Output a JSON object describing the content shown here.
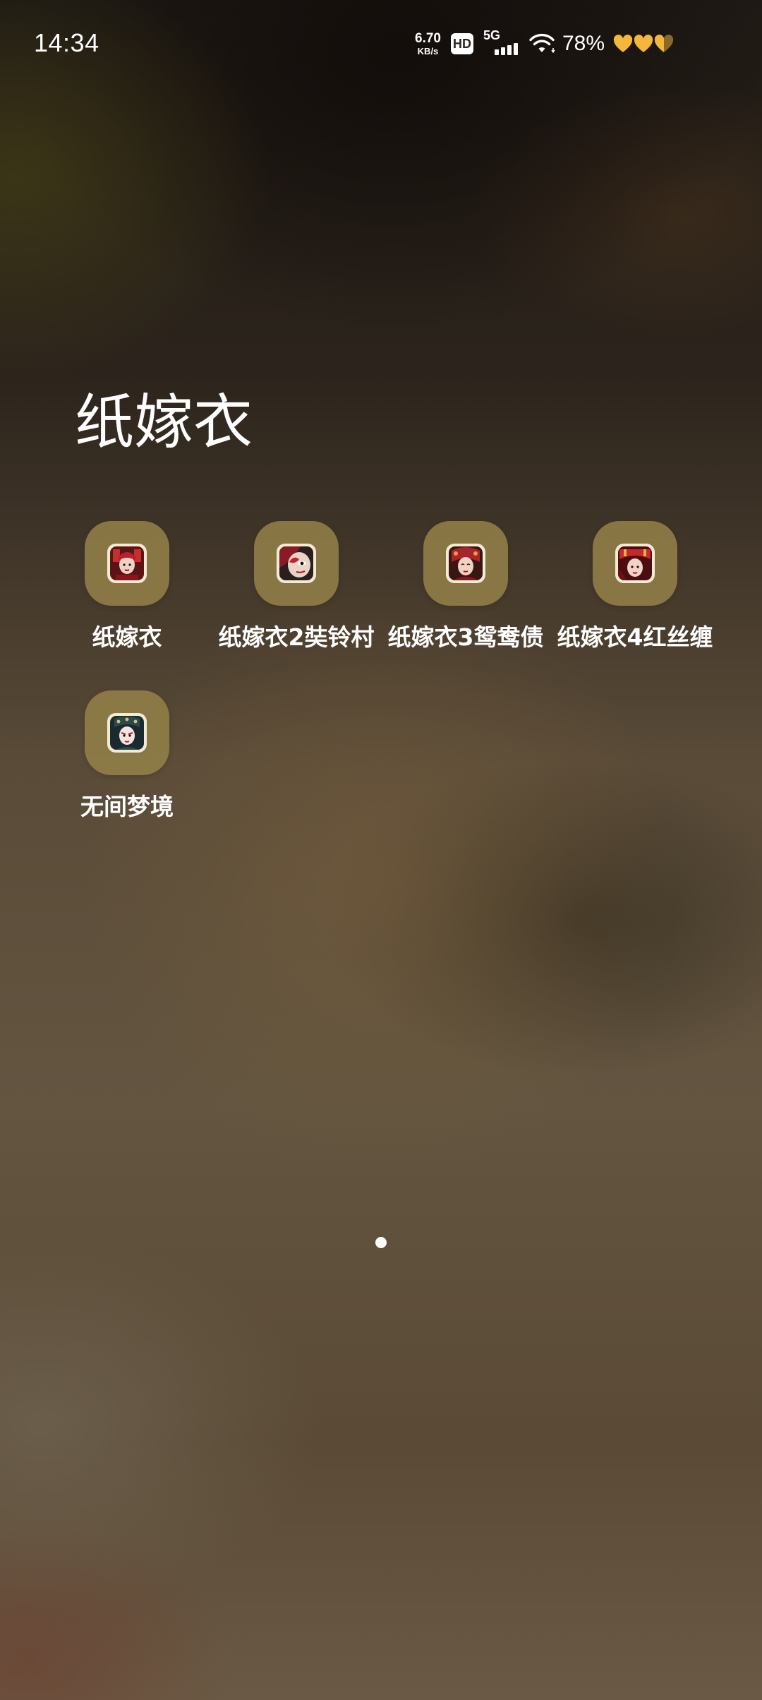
{
  "status_bar": {
    "time": "14:34",
    "net_speed_value": "6.70",
    "net_speed_unit": "KB/s",
    "hd_badge": "HD",
    "network_type": "5G",
    "battery_percent": "78%",
    "icons": [
      "wifi-icon",
      "signal-icon",
      "heart-battery-icon"
    ]
  },
  "folder": {
    "title": "纸嫁衣",
    "apps": [
      {
        "label": "纸嫁衣",
        "icon": "app-icon-zhijiayi"
      },
      {
        "label": "纸嫁衣2奘铃村",
        "icon": "app-icon-zhijiayi2"
      },
      {
        "label": "纸嫁衣3鸳鸯债",
        "icon": "app-icon-zhijiayi3"
      },
      {
        "label": "纸嫁衣4红丝缠",
        "icon": "app-icon-zhijiayi4"
      },
      {
        "label": "无间梦境",
        "icon": "app-icon-wujianmengjing"
      }
    ]
  },
  "page_indicator": {
    "pages": 1,
    "current": 1
  },
  "colors": {
    "tile": "#928048",
    "text": "#ffffff",
    "hearts": "#f2b73b"
  }
}
